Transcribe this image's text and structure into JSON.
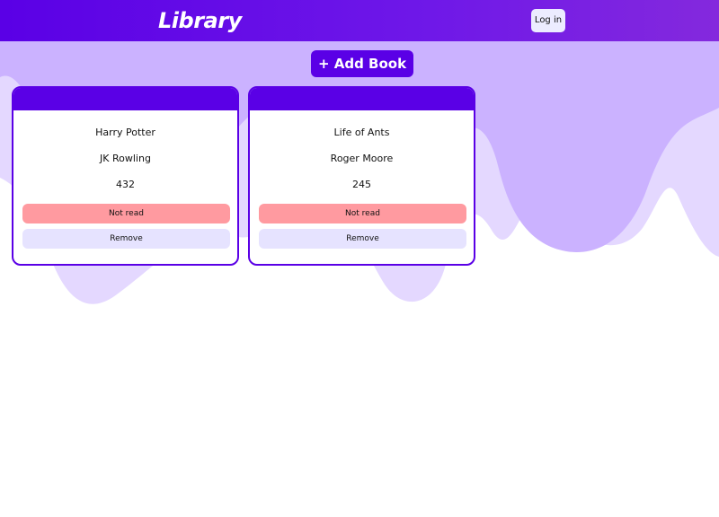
{
  "colors": {
    "header_start": "#5a00e6",
    "header_end": "#8429dd",
    "accent": "#5a00e6",
    "wave_dark": "#cbb2ff",
    "wave_light": "#e4d8ff",
    "not_read_button": "#ff9aa0",
    "remove_button": "#e6e3ff",
    "login_button": "#ececff"
  },
  "header": {
    "title": "Library",
    "login_label": "Log in"
  },
  "toolbar": {
    "add_book_label": "+ Add Book"
  },
  "books": [
    {
      "title": "Harry Potter",
      "author": "JK Rowling",
      "pages": "432",
      "status_label": "Not read",
      "remove_label": "Remove"
    },
    {
      "title": "Life of Ants",
      "author": "Roger Moore",
      "pages": "245",
      "status_label": "Not read",
      "remove_label": "Remove"
    }
  ]
}
